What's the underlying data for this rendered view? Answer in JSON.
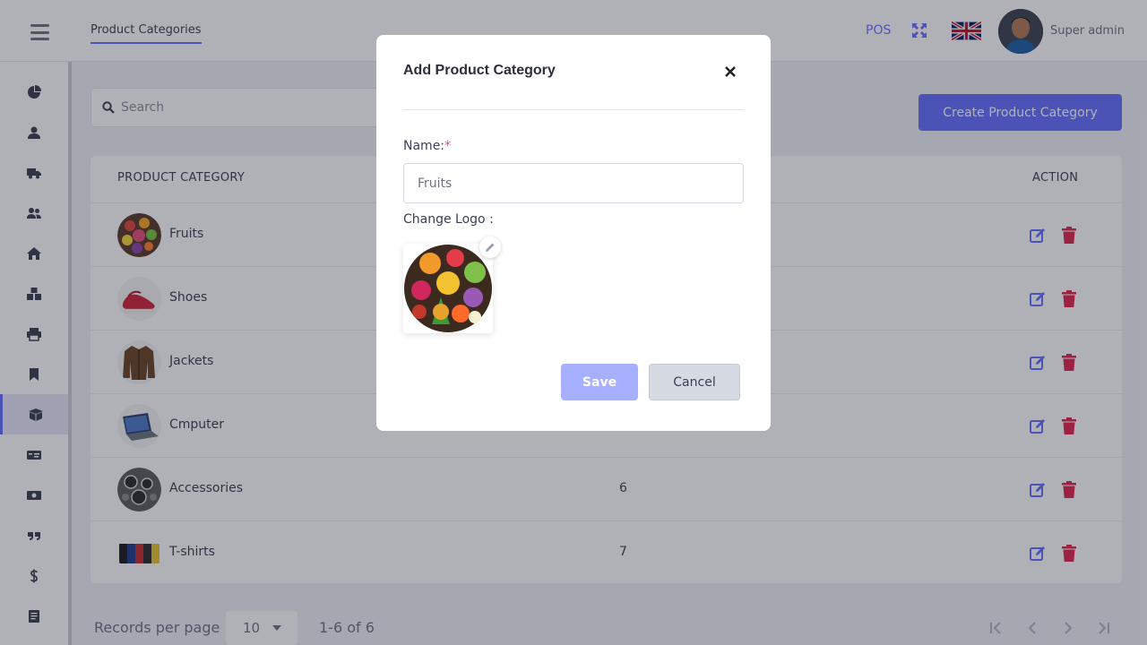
{
  "header": {
    "tab_label": "Product Categories",
    "pos_label": "POS",
    "user_name": "Super admin"
  },
  "sidebar": {
    "items": [
      {
        "icon": "dashboard-icon"
      },
      {
        "icon": "user-icon"
      },
      {
        "icon": "truck-icon"
      },
      {
        "icon": "users-icon"
      },
      {
        "icon": "home-icon"
      },
      {
        "icon": "boxes-icon"
      },
      {
        "icon": "printer-icon"
      },
      {
        "icon": "bookmark-icon"
      },
      {
        "icon": "product-box-icon",
        "active": true
      },
      {
        "icon": "id-card-icon"
      },
      {
        "icon": "money-icon"
      },
      {
        "icon": "quote-icon"
      },
      {
        "icon": "dollar-icon"
      },
      {
        "icon": "report-icon"
      }
    ]
  },
  "search": {
    "placeholder": "Search"
  },
  "create_button_label": "Create Product Category",
  "table": {
    "headers": {
      "category": "PRODUCT CATEGORY",
      "action": "ACTION"
    },
    "rows": [
      {
        "name": "Fruits",
        "count": ""
      },
      {
        "name": "Shoes",
        "count": ""
      },
      {
        "name": "Jackets",
        "count": ""
      },
      {
        "name": "Cmputer",
        "count": ""
      },
      {
        "name": "Accessories",
        "count": "6"
      },
      {
        "name": "T-shirts",
        "count": "7"
      }
    ]
  },
  "pagination": {
    "records_label": "Records per page",
    "per_page": "10",
    "range": "1-6 of 6"
  },
  "modal": {
    "title": "Add Product Category",
    "name_label": "Name:",
    "name_required": "*",
    "name_value": "Fruits",
    "logo_label": "Change Logo :",
    "save_label": "Save",
    "cancel_label": "Cancel"
  },
  "colors": {
    "accent": "#6571ff",
    "delete": "#e0244f",
    "save_disabled": "#a7afff"
  }
}
